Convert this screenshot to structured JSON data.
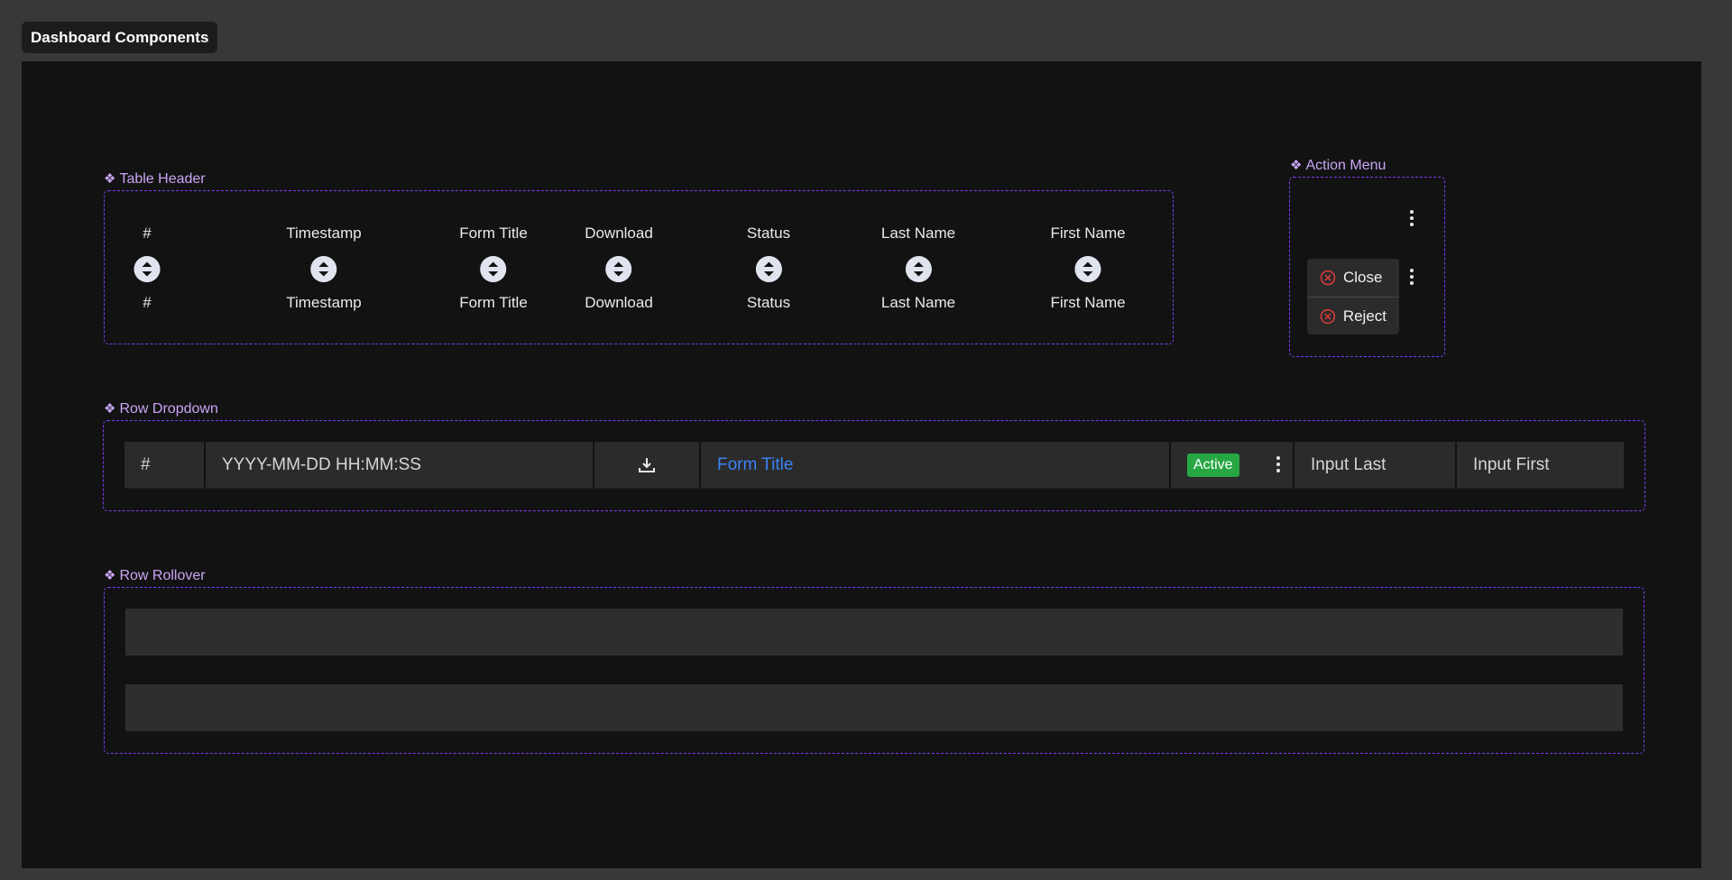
{
  "frame": {
    "title": "Dashboard Components"
  },
  "colors": {
    "accent": "#7b3ff2",
    "label": "#c9a6f5",
    "link": "#3b82f6",
    "active": "#27a744",
    "danger": "#e23b3b"
  },
  "table_header": {
    "label": "Table Header",
    "columns": [
      {
        "top": "#",
        "bottom": "#"
      },
      {
        "top": "Timestamp",
        "bottom": "Timestamp"
      },
      {
        "top": "Form Title",
        "bottom": "Form Title"
      },
      {
        "top": "Download",
        "bottom": "Download"
      },
      {
        "top": "Status",
        "bottom": "Status"
      },
      {
        "top": "Last Name",
        "bottom": "Last Name"
      },
      {
        "top": "First Name",
        "bottom": "First Name"
      }
    ],
    "sort_icon": "sort-icon"
  },
  "action_menu": {
    "label": "Action Menu",
    "items": [
      {
        "label": "Close",
        "icon": "x-circle-icon"
      },
      {
        "label": "Reject",
        "icon": "x-circle-icon"
      }
    ]
  },
  "row_dropdown": {
    "label": "Row Dropdown",
    "number": "#",
    "timestamp": "YYYY-MM-DD HH:MM:SS",
    "download_icon": "download-icon",
    "form_title": "Form Title",
    "status": "Active",
    "last_name": "Input Last",
    "first_name": "Input First"
  },
  "row_rollover": {
    "label": "Row Rollover"
  }
}
